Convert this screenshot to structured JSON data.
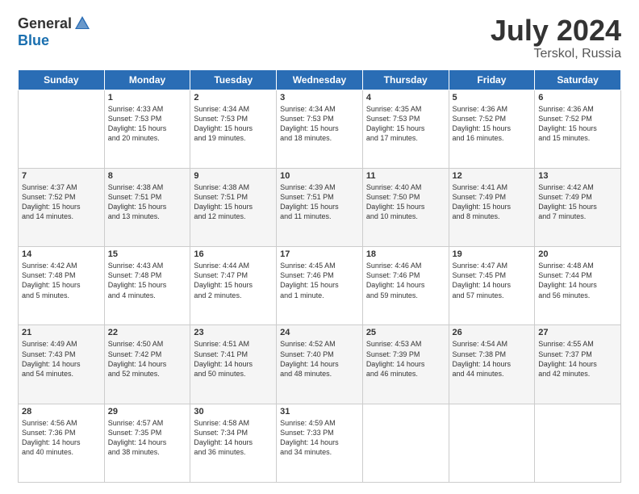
{
  "header": {
    "logo_general": "General",
    "logo_blue": "Blue",
    "main_title": "July 2024",
    "sub_title": "Terskol, Russia"
  },
  "days_of_week": [
    "Sunday",
    "Monday",
    "Tuesday",
    "Wednesday",
    "Thursday",
    "Friday",
    "Saturday"
  ],
  "weeks": [
    {
      "shade": "white",
      "days": [
        {
          "num": "",
          "info": ""
        },
        {
          "num": "1",
          "info": "Sunrise: 4:33 AM\nSunset: 7:53 PM\nDaylight: 15 hours\nand 20 minutes."
        },
        {
          "num": "2",
          "info": "Sunrise: 4:34 AM\nSunset: 7:53 PM\nDaylight: 15 hours\nand 19 minutes."
        },
        {
          "num": "3",
          "info": "Sunrise: 4:34 AM\nSunset: 7:53 PM\nDaylight: 15 hours\nand 18 minutes."
        },
        {
          "num": "4",
          "info": "Sunrise: 4:35 AM\nSunset: 7:53 PM\nDaylight: 15 hours\nand 17 minutes."
        },
        {
          "num": "5",
          "info": "Sunrise: 4:36 AM\nSunset: 7:52 PM\nDaylight: 15 hours\nand 16 minutes."
        },
        {
          "num": "6",
          "info": "Sunrise: 4:36 AM\nSunset: 7:52 PM\nDaylight: 15 hours\nand 15 minutes."
        }
      ]
    },
    {
      "shade": "shade",
      "days": [
        {
          "num": "7",
          "info": "Sunrise: 4:37 AM\nSunset: 7:52 PM\nDaylight: 15 hours\nand 14 minutes."
        },
        {
          "num": "8",
          "info": "Sunrise: 4:38 AM\nSunset: 7:51 PM\nDaylight: 15 hours\nand 13 minutes."
        },
        {
          "num": "9",
          "info": "Sunrise: 4:38 AM\nSunset: 7:51 PM\nDaylight: 15 hours\nand 12 minutes."
        },
        {
          "num": "10",
          "info": "Sunrise: 4:39 AM\nSunset: 7:51 PM\nDaylight: 15 hours\nand 11 minutes."
        },
        {
          "num": "11",
          "info": "Sunrise: 4:40 AM\nSunset: 7:50 PM\nDaylight: 15 hours\nand 10 minutes."
        },
        {
          "num": "12",
          "info": "Sunrise: 4:41 AM\nSunset: 7:49 PM\nDaylight: 15 hours\nand 8 minutes."
        },
        {
          "num": "13",
          "info": "Sunrise: 4:42 AM\nSunset: 7:49 PM\nDaylight: 15 hours\nand 7 minutes."
        }
      ]
    },
    {
      "shade": "white",
      "days": [
        {
          "num": "14",
          "info": "Sunrise: 4:42 AM\nSunset: 7:48 PM\nDaylight: 15 hours\nand 5 minutes."
        },
        {
          "num": "15",
          "info": "Sunrise: 4:43 AM\nSunset: 7:48 PM\nDaylight: 15 hours\nand 4 minutes."
        },
        {
          "num": "16",
          "info": "Sunrise: 4:44 AM\nSunset: 7:47 PM\nDaylight: 15 hours\nand 2 minutes."
        },
        {
          "num": "17",
          "info": "Sunrise: 4:45 AM\nSunset: 7:46 PM\nDaylight: 15 hours\nand 1 minute."
        },
        {
          "num": "18",
          "info": "Sunrise: 4:46 AM\nSunset: 7:46 PM\nDaylight: 14 hours\nand 59 minutes."
        },
        {
          "num": "19",
          "info": "Sunrise: 4:47 AM\nSunset: 7:45 PM\nDaylight: 14 hours\nand 57 minutes."
        },
        {
          "num": "20",
          "info": "Sunrise: 4:48 AM\nSunset: 7:44 PM\nDaylight: 14 hours\nand 56 minutes."
        }
      ]
    },
    {
      "shade": "shade",
      "days": [
        {
          "num": "21",
          "info": "Sunrise: 4:49 AM\nSunset: 7:43 PM\nDaylight: 14 hours\nand 54 minutes."
        },
        {
          "num": "22",
          "info": "Sunrise: 4:50 AM\nSunset: 7:42 PM\nDaylight: 14 hours\nand 52 minutes."
        },
        {
          "num": "23",
          "info": "Sunrise: 4:51 AM\nSunset: 7:41 PM\nDaylight: 14 hours\nand 50 minutes."
        },
        {
          "num": "24",
          "info": "Sunrise: 4:52 AM\nSunset: 7:40 PM\nDaylight: 14 hours\nand 48 minutes."
        },
        {
          "num": "25",
          "info": "Sunrise: 4:53 AM\nSunset: 7:39 PM\nDaylight: 14 hours\nand 46 minutes."
        },
        {
          "num": "26",
          "info": "Sunrise: 4:54 AM\nSunset: 7:38 PM\nDaylight: 14 hours\nand 44 minutes."
        },
        {
          "num": "27",
          "info": "Sunrise: 4:55 AM\nSunset: 7:37 PM\nDaylight: 14 hours\nand 42 minutes."
        }
      ]
    },
    {
      "shade": "white",
      "days": [
        {
          "num": "28",
          "info": "Sunrise: 4:56 AM\nSunset: 7:36 PM\nDaylight: 14 hours\nand 40 minutes."
        },
        {
          "num": "29",
          "info": "Sunrise: 4:57 AM\nSunset: 7:35 PM\nDaylight: 14 hours\nand 38 minutes."
        },
        {
          "num": "30",
          "info": "Sunrise: 4:58 AM\nSunset: 7:34 PM\nDaylight: 14 hours\nand 36 minutes."
        },
        {
          "num": "31",
          "info": "Sunrise: 4:59 AM\nSunset: 7:33 PM\nDaylight: 14 hours\nand 34 minutes."
        },
        {
          "num": "",
          "info": ""
        },
        {
          "num": "",
          "info": ""
        },
        {
          "num": "",
          "info": ""
        }
      ]
    }
  ]
}
